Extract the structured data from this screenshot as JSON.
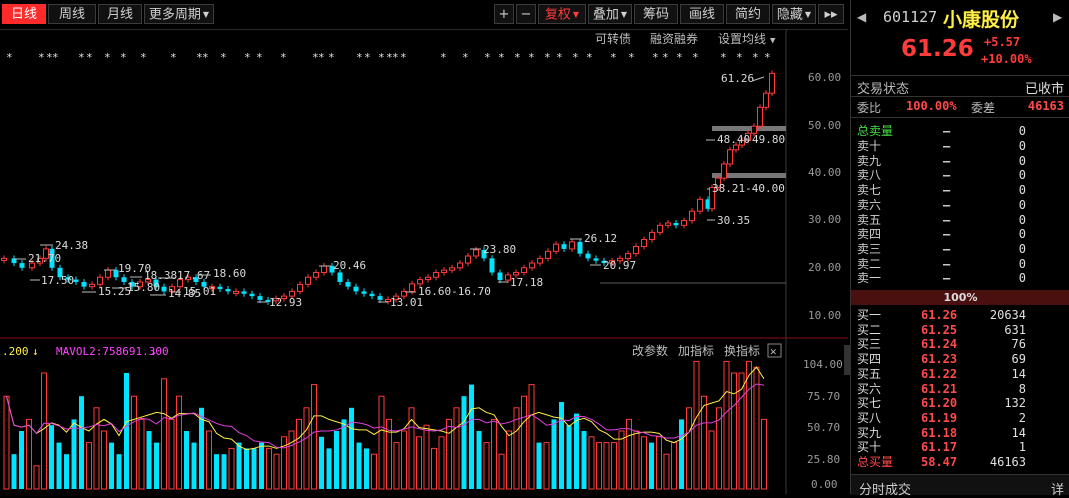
{
  "toolbar": {
    "tabs": [
      "日线",
      "周线",
      "月线"
    ],
    "more_periods": "更多周期",
    "plus": "+",
    "minus": "−",
    "fuquan": "复权",
    "overlay": "叠加",
    "chips": "筹码",
    "draw": "画线",
    "simple": "简约",
    "hide": "隐藏",
    "scroll_right": "▸▸"
  },
  "chart_header": {
    "convertible": "可转债",
    "margin": "融资融券",
    "ma_settings": "设置均线"
  },
  "price_axis": [
    "60.00",
    "50.00",
    "40.00",
    "30.00",
    "20.00",
    "10.00"
  ],
  "volume_axis": [
    "104.00",
    "75.70",
    "50.70",
    "25.80",
    "0.00"
  ],
  "annotations": {
    "a1": "24.38",
    "a2": "21.70",
    "a3": "17.50",
    "a4": "19.70",
    "a5": "15.25",
    "a6": "18.38",
    "a7": "15.80",
    "a8": "17.67",
    "a9": "14.85",
    "a10": "18.60",
    "a11": "15.01",
    "a12": "12.93",
    "a13": "20.46",
    "a14": "13.01",
    "a15": "16.60-16.70",
    "a16": "23.80",
    "a17": "17.18",
    "a18": "26.12",
    "a19": "20.97",
    "a20": "30.35",
    "a21": "38.21-40.00",
    "a22": "48.40",
    "a23": "49.80",
    "a24": "61.26"
  },
  "volume_header": {
    "ma_left": ".200",
    "mavol2": "MAVOL2:758691.300",
    "params": "改参数",
    "add": "加指标",
    "switch": "换指标",
    "close": "✕"
  },
  "stock": {
    "code": "601127",
    "name": "小康股份",
    "price": "61.26",
    "change": "+5.57",
    "pct": "+10.00%",
    "status_label": "交易状态",
    "status_value": "已收市",
    "ratio_label": "委比",
    "ratio_value": "100.00%",
    "diff_label": "委差",
    "diff_value": "46163"
  },
  "sell": {
    "total_label": "总卖量",
    "total_price": "—",
    "total_vol": "0",
    "rows": [
      {
        "label": "卖十",
        "price": "—",
        "vol": "0"
      },
      {
        "label": "卖九",
        "price": "—",
        "vol": "0"
      },
      {
        "label": "卖八",
        "price": "—",
        "vol": "0"
      },
      {
        "label": "卖七",
        "price": "—",
        "vol": "0"
      },
      {
        "label": "卖六",
        "price": "—",
        "vol": "0"
      },
      {
        "label": "卖五",
        "price": "—",
        "vol": "0"
      },
      {
        "label": "卖四",
        "price": "—",
        "vol": "0"
      },
      {
        "label": "卖三",
        "price": "—",
        "vol": "0"
      },
      {
        "label": "卖二",
        "price": "—",
        "vol": "0"
      },
      {
        "label": "卖一",
        "price": "—",
        "vol": "0"
      }
    ]
  },
  "ratio_bar": "100%",
  "buy": {
    "rows": [
      {
        "label": "买一",
        "price": "61.26",
        "vol": "20634"
      },
      {
        "label": "买二",
        "price": "61.25",
        "vol": "631"
      },
      {
        "label": "买三",
        "price": "61.24",
        "vol": "76"
      },
      {
        "label": "买四",
        "price": "61.23",
        "vol": "69"
      },
      {
        "label": "买五",
        "price": "61.22",
        "vol": "14"
      },
      {
        "label": "买六",
        "price": "61.21",
        "vol": "8"
      },
      {
        "label": "买七",
        "price": "61.20",
        "vol": "132"
      },
      {
        "label": "买八",
        "price": "61.19",
        "vol": "2"
      },
      {
        "label": "买九",
        "price": "61.18",
        "vol": "14"
      },
      {
        "label": "买十",
        "price": "61.17",
        "vol": "1"
      }
    ],
    "total_label": "总买量",
    "total_price": "58.47",
    "total_vol": "46163"
  },
  "footer": {
    "trades": "分时成交",
    "detail": "详"
  },
  "colors": {
    "up": "#ff3b3b",
    "down": "#00e5ff",
    "accent": "#ff2a2a",
    "bg": "#000000"
  }
}
